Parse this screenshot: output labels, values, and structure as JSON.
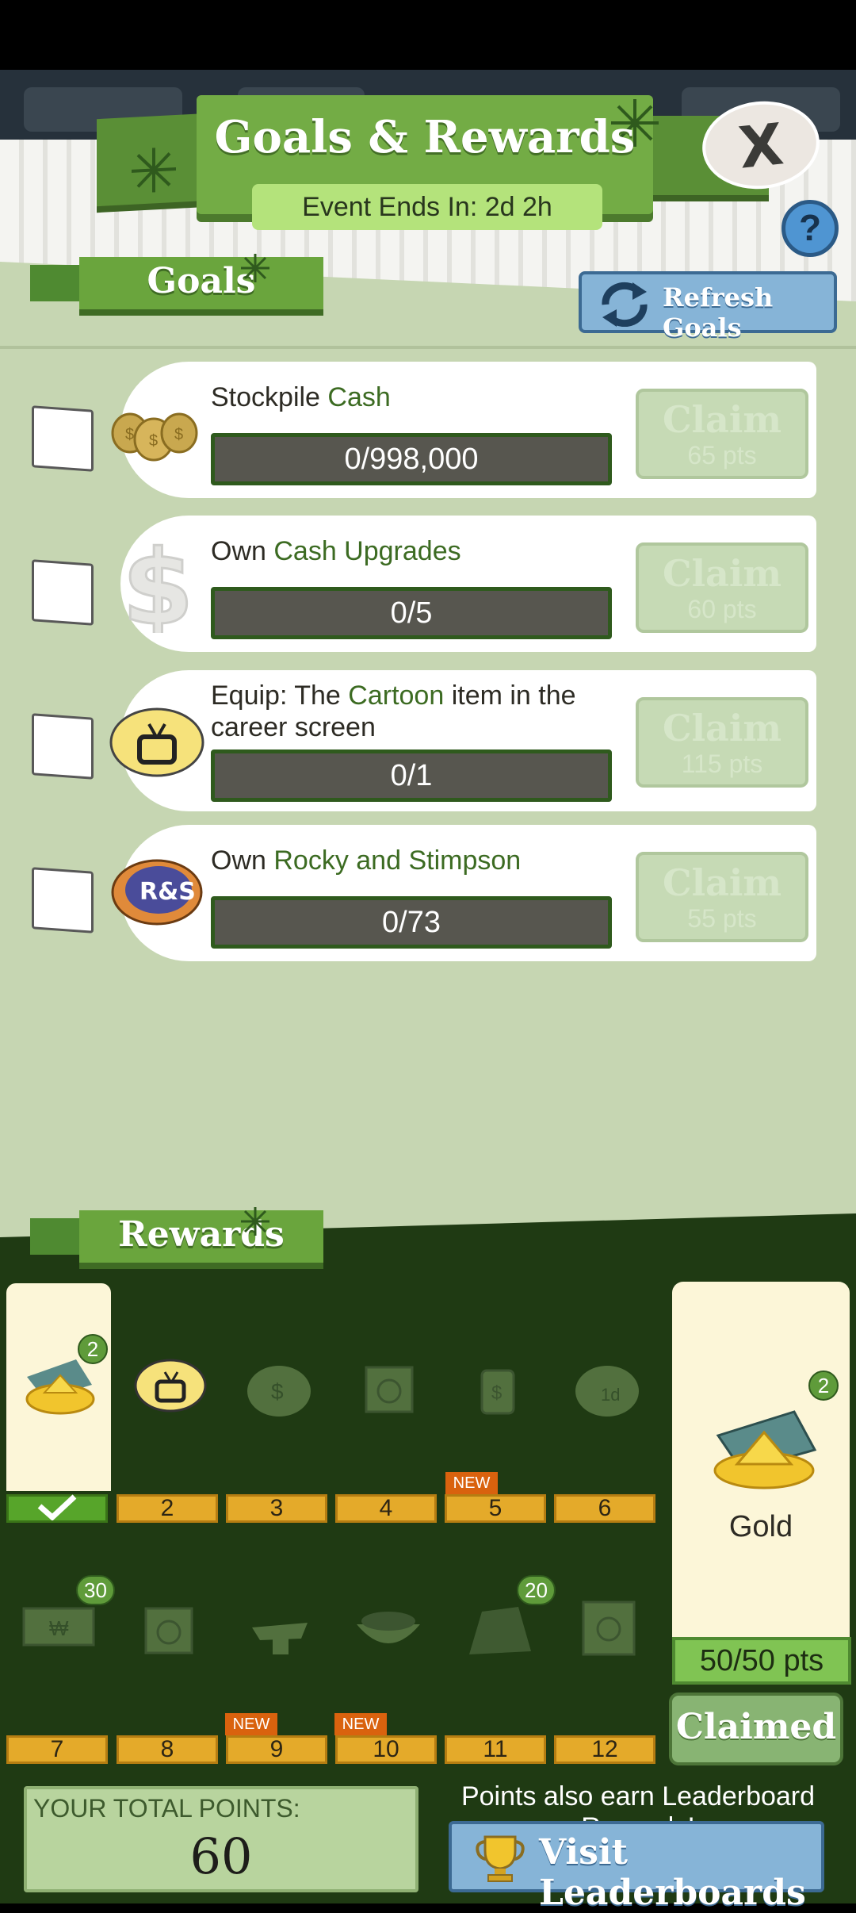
{
  "header": {
    "title": "Goals & Rewards",
    "event_ends": "Event Ends In: 2d 2h",
    "close_label": "X",
    "help_label": "?"
  },
  "goals_section": {
    "tab_label": "Goals",
    "refresh_label": "Refresh Goals",
    "items": [
      {
        "pre": "Stockpile ",
        "hl": "Cash",
        "post": "",
        "progress": "0/998,000",
        "progress_fraction": 0,
        "claim": "Claim",
        "pts": "65 pts",
        "icon": "money-bags-icon"
      },
      {
        "pre": "Own ",
        "hl": "Cash Upgrades",
        "post": "",
        "progress": "0/5",
        "progress_fraction": 0,
        "claim": "Claim",
        "pts": "60 pts",
        "icon": "dollar-sign-icon"
      },
      {
        "pre": "Equip: The ",
        "hl": "Cartoon",
        "post": " item in the career screen",
        "progress": "0/1",
        "progress_fraction": 0,
        "claim": "Claim",
        "pts": "115 pts",
        "icon": "tv-icon"
      },
      {
        "pre": "Own ",
        "hl": "Rocky and Stimpson",
        "post": "",
        "progress": "0/73",
        "progress_fraction": 0,
        "claim": "Claim",
        "pts": "55 pts",
        "icon": "rocky-stimpson-logo-icon"
      }
    ]
  },
  "rewards_section": {
    "tab_label": "Rewards",
    "row1": {
      "cells": [
        "",
        "2",
        "3",
        "4",
        "5",
        "6"
      ],
      "icons": [
        "gold-pile-icon",
        "tv-icon",
        "cash-bag-icon",
        "crate-icon",
        "card-icon",
        "timer-bag-icon"
      ],
      "counts": {
        "first": "2"
      },
      "new_label": "NEW"
    },
    "row2": {
      "cells": [
        "7",
        "8",
        "9",
        "10",
        "11",
        "12"
      ],
      "icons": [
        "cash-bill-icon",
        "crate-icon",
        "anvil-icon",
        "bowl-icon",
        "cash-pile-icon",
        "safe-icon"
      ],
      "counts": {
        "first": "30",
        "fifth": "20"
      },
      "new_label": "NEW"
    },
    "featured": {
      "count": "2",
      "name": "Gold",
      "pts": "50/50 pts",
      "claimed_label": "Claimed"
    }
  },
  "footer": {
    "total_label": "YOUR TOTAL POINTS:",
    "total_value": "60",
    "leaderboard_note": "Points also earn Leaderboard Rewards!",
    "leaderboard_button": "Visit Leaderboards"
  },
  "colors": {
    "accent_green": "#73ac45",
    "dark_green": "#1f3a13",
    "blue_button": "#86b4d7",
    "gold_cell": "#e4aa2a",
    "new_badge": "#d9620e"
  }
}
